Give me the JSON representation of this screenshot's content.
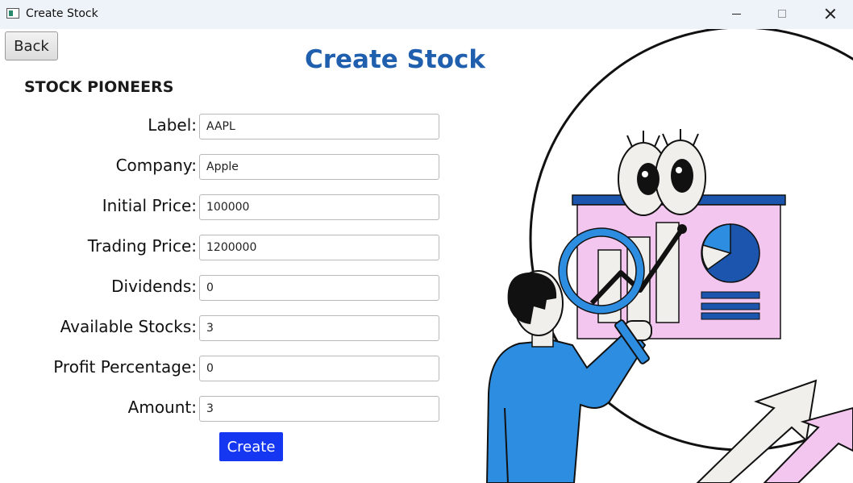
{
  "window": {
    "title": "Create Stock"
  },
  "nav": {
    "back_label": "Back"
  },
  "page": {
    "title": "Create Stock",
    "brand": "STOCK PIONEERS"
  },
  "form": {
    "fields": [
      {
        "label": "Label:",
        "value": "AAPL"
      },
      {
        "label": "Company:",
        "value": "Apple"
      },
      {
        "label": "Initial Price:",
        "value": "100000"
      },
      {
        "label": "Trading Price:",
        "value": "1200000"
      },
      {
        "label": "Dividends:",
        "value": "0"
      },
      {
        "label": "Available Stocks:",
        "value": "3"
      },
      {
        "label": "Profit Percentage:",
        "value": "0"
      },
      {
        "label": "Amount:",
        "value": "3"
      }
    ],
    "submit_label": "Create"
  },
  "colors": {
    "accent": "#1637f2",
    "title": "#1f5fae",
    "titlebar": "#eef3fa"
  }
}
